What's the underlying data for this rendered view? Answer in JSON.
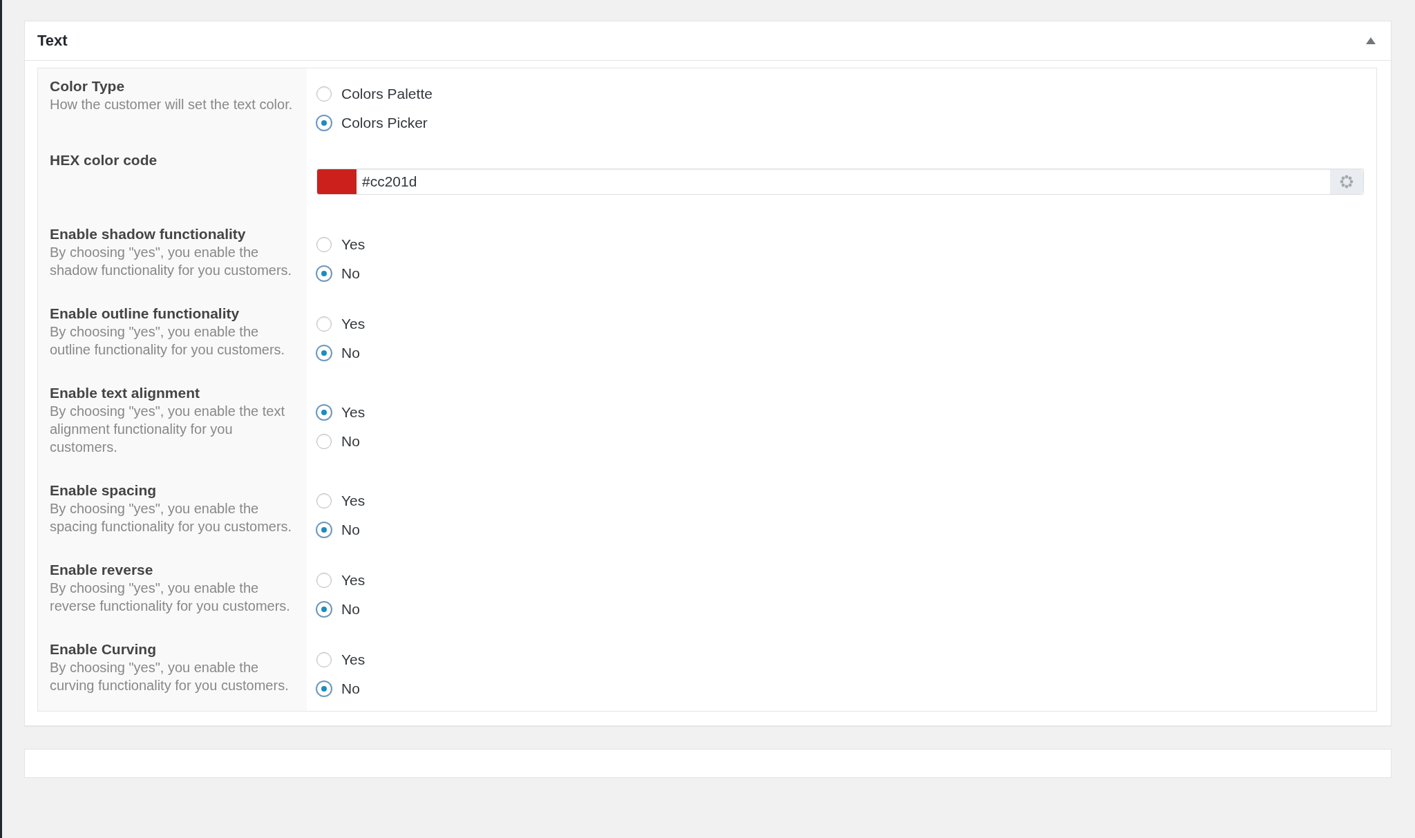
{
  "panel": {
    "title": "Text",
    "expanded": true,
    "fields": [
      {
        "kind": "radio",
        "label": "Color Type",
        "description": "How the customer will set the text color.",
        "options": [
          {
            "label": "Colors Palette",
            "selected": false
          },
          {
            "label": "Colors Picker",
            "selected": true
          }
        ]
      },
      {
        "kind": "color",
        "label": "HEX color code",
        "value": "#cc201d",
        "color": "#cc201d"
      },
      {
        "kind": "radio",
        "label": "Enable shadow functionality",
        "description": "By choosing \"yes\", you enable the shadow functionality for you customers.",
        "options": [
          {
            "label": "Yes",
            "selected": false
          },
          {
            "label": "No",
            "selected": true
          }
        ]
      },
      {
        "kind": "radio",
        "label": "Enable outline functionality",
        "description": "By choosing \"yes\", you enable the outline functionality for you customers.",
        "options": [
          {
            "label": "Yes",
            "selected": false
          },
          {
            "label": "No",
            "selected": true
          }
        ]
      },
      {
        "kind": "radio",
        "label": "Enable text alignment",
        "description": "By choosing \"yes\", you enable the text alignment functionality for you customers.",
        "options": [
          {
            "label": "Yes",
            "selected": true
          },
          {
            "label": "No",
            "selected": false
          }
        ]
      },
      {
        "kind": "radio",
        "label": "Enable spacing",
        "description": "By choosing \"yes\", you enable the spacing functionality for you customers.",
        "options": [
          {
            "label": "Yes",
            "selected": false
          },
          {
            "label": "No",
            "selected": true
          }
        ]
      },
      {
        "kind": "radio",
        "label": "Enable reverse",
        "description": "By choosing \"yes\", you enable the reverse functionality for you customers.",
        "options": [
          {
            "label": "Yes",
            "selected": false
          },
          {
            "label": "No",
            "selected": true
          }
        ]
      },
      {
        "kind": "radio",
        "label": "Enable Curving",
        "description": "By choosing \"yes\", you enable the curving functionality for you customers.",
        "options": [
          {
            "label": "Yes",
            "selected": false
          },
          {
            "label": "No",
            "selected": true
          }
        ]
      }
    ]
  }
}
